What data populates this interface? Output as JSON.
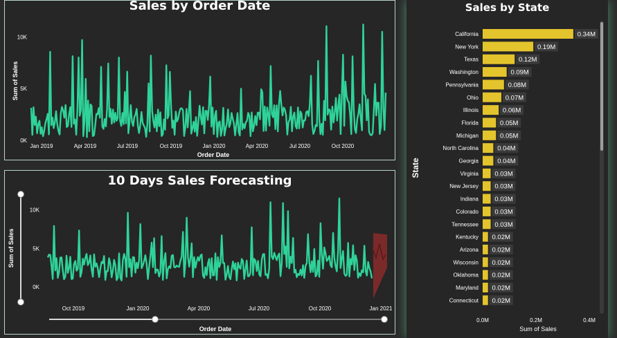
{
  "colors": {
    "line": "#2fd39a",
    "forecast": "#8b2c2c",
    "bar": "#e3c42c",
    "label_bg": "#3a3a3a",
    "panel": "#262626",
    "text": "#ffffff"
  },
  "panel1": {
    "title": "Sales by Order Date"
  },
  "panel2": {
    "title": "10 Days Sales Forecasting"
  },
  "panel3": {
    "title": "Sales by State"
  },
  "chart_data": [
    {
      "type": "line",
      "title": "Sales by Order Date",
      "xlabel": "Order Date",
      "ylabel": "Sum of Sales",
      "y_ticks": [
        "0K",
        "5K",
        "10K"
      ],
      "x_ticks": [
        "Jan 2019",
        "Apr 2019",
        "Jul 2019",
        "Oct 2019",
        "Jan 2020",
        "Apr 2020",
        "Jul 2020",
        "Oct 2020"
      ],
      "ylim": [
        0,
        11500
      ],
      "grid": false,
      "series": [
        {
          "values": []
        }
      ]
    },
    {
      "type": "line",
      "title": "10 Days Sales Forecasting",
      "xlabel": "Order Date",
      "ylabel": "Sum of Sales",
      "y_ticks": [
        "0K",
        "5K",
        "10K"
      ],
      "x_ticks": [
        "Oct 2019",
        "Jan 2020",
        "Apr 2020",
        "Jul 2020",
        "Oct 2020",
        "Jan 2021"
      ],
      "ylim": [
        0,
        11500
      ],
      "grid": false,
      "series": [
        {
          "values": []
        }
      ]
    },
    {
      "type": "bar",
      "orientation": "horizontal",
      "title": "Sales by State",
      "xlabel": "Sum of Sales",
      "ylabel": "State",
      "x_ticks": [
        "0.0M",
        "0.2M",
        "0.4M"
      ],
      "xlim": [
        0,
        0.4
      ],
      "categories": [
        "California",
        "New York",
        "Texas",
        "Washington",
        "Pennsylvania",
        "Ohio",
        "Illinois",
        "Florida",
        "Michigan",
        "North Carolina",
        "Georgia",
        "Virginia",
        "New Jersey",
        "Indiana",
        "Colorado",
        "Tennessee",
        "Kentucky",
        "Arizona",
        "Wisconsin",
        "Oklahoma",
        "Maryland",
        "Connecticut"
      ],
      "values": [
        0.34,
        0.19,
        0.12,
        0.09,
        0.08,
        0.07,
        0.06,
        0.05,
        0.05,
        0.04,
        0.04,
        0.03,
        0.03,
        0.03,
        0.03,
        0.03,
        0.02,
        0.02,
        0.02,
        0.02,
        0.02,
        0.02
      ],
      "labels": [
        "0.34M",
        "0.19M",
        "0.12M",
        "0.09M",
        "0.08M",
        "0.07M",
        "0.06M",
        "0.05M",
        "0.05M",
        "0.04M",
        "0.04M",
        "0.03M",
        "0.03M",
        "0.03M",
        "0.03M",
        "0.03M",
        "0.02M",
        "0.02M",
        "0.02M",
        "0.02M",
        "0.02M",
        "0.02M"
      ]
    }
  ]
}
